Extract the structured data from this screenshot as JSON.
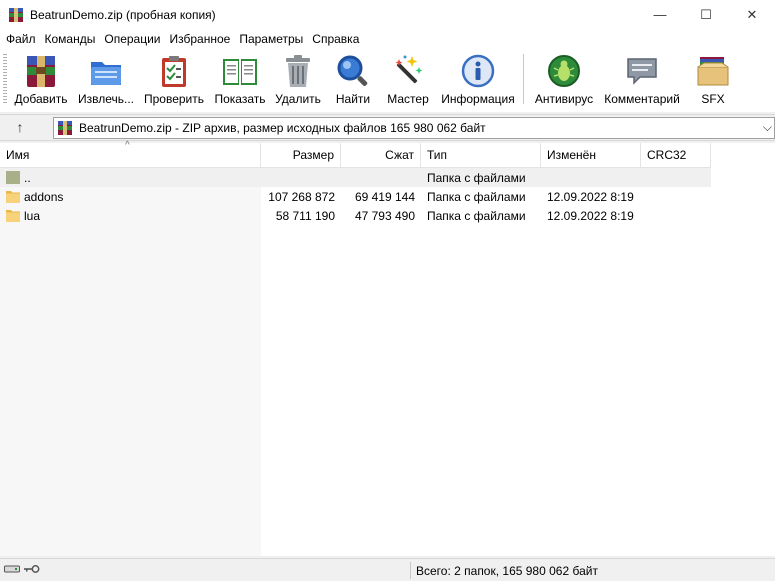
{
  "window": {
    "title": "BeatrunDemo.zip (пробная копия)",
    "controls": {
      "minimize": "—",
      "maximize": "☐",
      "close": "✕"
    }
  },
  "menu": [
    "Файл",
    "Команды",
    "Операции",
    "Избранное",
    "Параметры",
    "Справка"
  ],
  "toolbar": {
    "buttons": [
      {
        "label": "Добавить",
        "icon": "add-archive-icon"
      },
      {
        "label": "Извлечь...",
        "icon": "extract-folder-icon"
      },
      {
        "label": "Проверить",
        "icon": "test-clipboard-icon"
      },
      {
        "label": "Показать",
        "icon": "view-book-icon"
      },
      {
        "label": "Удалить",
        "icon": "trash-icon"
      },
      {
        "label": "Найти",
        "icon": "magnifier-icon"
      },
      {
        "label": "Мастер",
        "icon": "magic-wand-icon"
      },
      {
        "label": "Информация",
        "icon": "info-icon"
      },
      {
        "label": "Антивирус",
        "icon": "antivirus-bug-icon"
      },
      {
        "label": "Комментарий",
        "icon": "comment-icon"
      },
      {
        "label": "SFX",
        "icon": "sfx-box-icon"
      }
    ]
  },
  "address": {
    "up_label": "↑",
    "path": "BeatrunDemo.zip - ZIP архив, размер исходных файлов 165 980 062 байт",
    "dropdown": "⌵"
  },
  "columns": [
    "Имя",
    "Размер",
    "Сжат",
    "Тип",
    "Изменён",
    "CRC32"
  ],
  "sort_indicator": "^",
  "rows": [
    {
      "name": "..",
      "size": "",
      "packed": "",
      "type": "Папка с файлами",
      "modified": "",
      "crc": "",
      "icon": "parent-folder-icon"
    },
    {
      "name": "addons",
      "size": "107 268 872",
      "packed": "69 419 144",
      "type": "Папка с файлами",
      "modified": "12.09.2022 8:19",
      "crc": "",
      "icon": "folder-icon"
    },
    {
      "name": "lua",
      "size": "58 711 190",
      "packed": "47 793 490",
      "type": "Папка с файлами",
      "modified": "12.09.2022 8:19",
      "crc": "",
      "icon": "folder-icon"
    }
  ],
  "status": {
    "text": "Всего: 2 папок, 165 980 062 байт"
  }
}
